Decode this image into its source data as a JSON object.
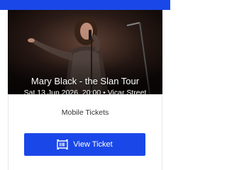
{
  "colors": {
    "brand": "#1a48e8",
    "background": "#ffffff",
    "hero_overlay": "#1c120f"
  },
  "event": {
    "title": "Mary Black - the Slan Tour",
    "subtitle": "Sat 13 Jun 2026, 20:00 • Vicar Street"
  },
  "tickets": {
    "section_label": "Mobile Tickets",
    "view_button_label": "View Ticket",
    "view_button_icon": "ticket-icon"
  }
}
